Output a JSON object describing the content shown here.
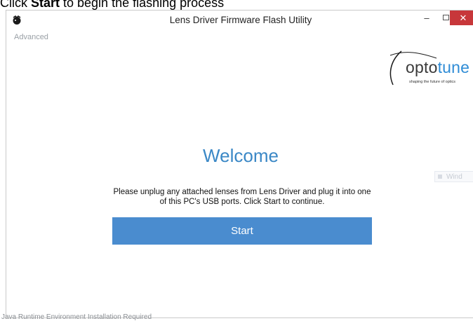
{
  "caption": {
    "prefix": "Click ",
    "bold": "Start",
    "suffix": " to begin the flashing process"
  },
  "window": {
    "title": "Lens Driver Firmware Flash Utility",
    "controls": {
      "minimize_icon": "minimize-icon",
      "maximize_icon": "maximize-icon",
      "close_icon": "close-icon"
    }
  },
  "advanced_link": "Advanced",
  "logo": {
    "opto": "opto",
    "tune": "tune",
    "tagline": "shaping the future of optics"
  },
  "welcome": {
    "heading": "Welcome",
    "message": "Please unplug any attached lenses from Lens Driver and plug it into one of this PC's USB ports. Click Start to continue."
  },
  "start_button": "Start",
  "overlapping_window_label": "Wind",
  "status_text": "Java Runtime Environment Installation Required",
  "colors": {
    "accent_blue": "#4a8ccf",
    "welcome_blue": "#3b88c6",
    "close_red": "#c7373a"
  }
}
